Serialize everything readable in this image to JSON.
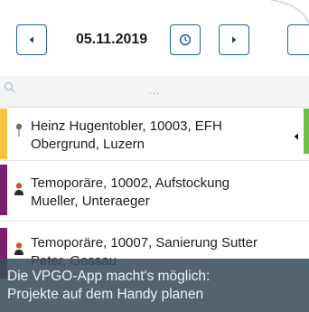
{
  "toolbar": {
    "date": "05.11.2019",
    "prev_icon": "chevron-left-icon",
    "clock_icon": "clock-icon",
    "next_icon": "chevron-right-icon"
  },
  "search": {
    "placeholder": "...",
    "icon": "search-icon"
  },
  "projects": [
    {
      "title": "Heinz Hugentobler, 10003, EFH",
      "subtitle": "Obergrund, Luzern",
      "color": "#f5c542",
      "icon": "location-pin-icon"
    },
    {
      "title": "Temoporäre, 10002, Aufstockung",
      "subtitle": "Mueller, Unteraeger",
      "color": "#7a1f6e",
      "icon": "person-icon"
    },
    {
      "title": "Temoporäre, 10007, Sanierung Sutter",
      "subtitle": "Peter, Gossau",
      "color": "#7a1f6e",
      "icon": "person-icon"
    }
  ],
  "caption": {
    "line1": "Die VPGO-App macht's möglich:",
    "line2": "Projekte auf dem Handy planen"
  },
  "colors": {
    "accent": "#1f5fa8",
    "status_green": "#6cc04a",
    "overlay": "#3a4e5c"
  }
}
